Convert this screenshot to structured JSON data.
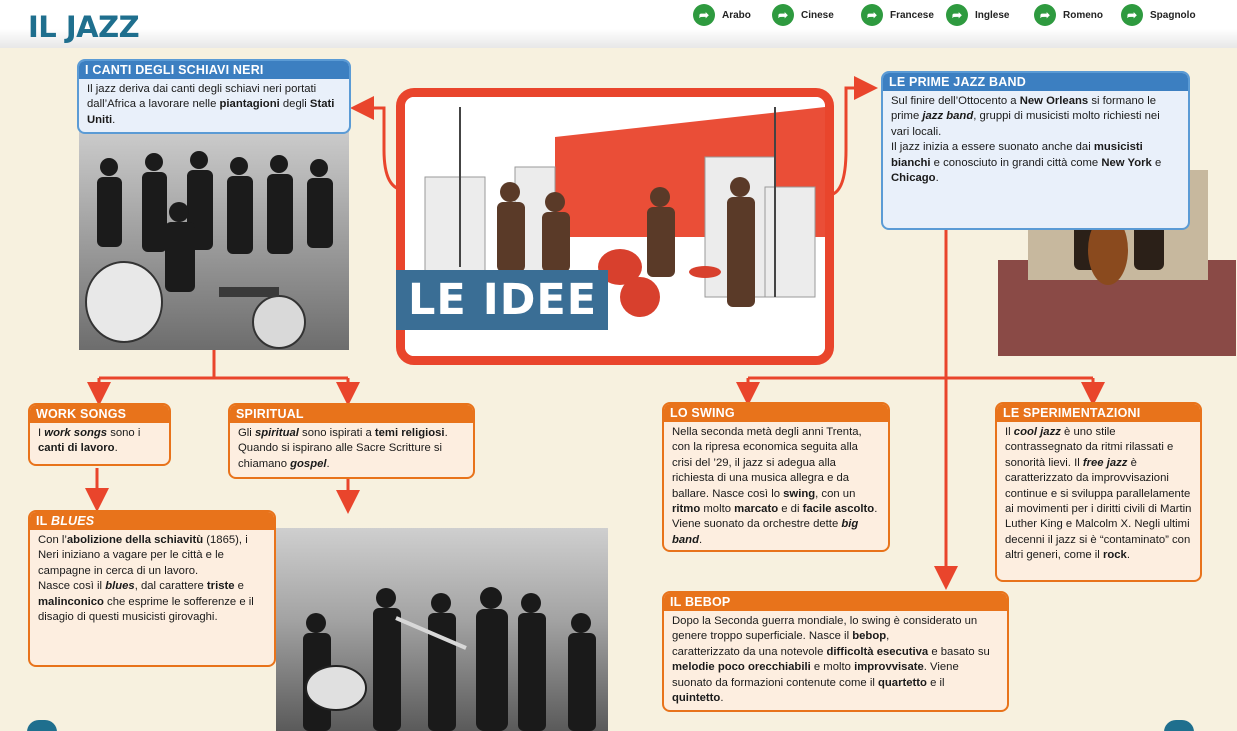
{
  "title": "IL JAZZ",
  "languages": [
    "Arabo",
    "Cinese",
    "Francese",
    "Inglese",
    "Romeno",
    "Spagnolo"
  ],
  "hub_label": "LE IDEE",
  "boxes": {
    "canti": {
      "title": "I CANTI DEGLI SCHIAVI NERI",
      "parts": [
        [
          "Il jazz deriva dai canti degli schiavi neri portati dall’Africa a lavorare nelle ",
          ""
        ],
        [
          "piantagioni",
          "b"
        ],
        [
          " degli ",
          ""
        ],
        [
          "Stati Uniti",
          "b"
        ],
        [
          ".",
          ""
        ]
      ]
    },
    "prime": {
      "title": "LE PRIME JAZZ BAND",
      "parts": [
        [
          "Sul finire dell’Ottocento a ",
          ""
        ],
        [
          "New Orleans",
          "b"
        ],
        [
          " si formano le prime ",
          ""
        ],
        [
          "jazz band",
          "bi"
        ],
        [
          ", gruppi di musicisti molto richiesti nei vari locali.",
          ""
        ],
        [
          "\n",
          "br"
        ],
        [
          "Il jazz inizia a essere suonato anche dai ",
          ""
        ],
        [
          "musicisti bianchi",
          "b"
        ],
        [
          " e conosciuto in grandi città come ",
          ""
        ],
        [
          "New York",
          "b"
        ],
        [
          " e ",
          ""
        ],
        [
          "Chicago",
          "b"
        ],
        [
          ".",
          ""
        ]
      ]
    },
    "work": {
      "title": "WORK SONGS",
      "parts": [
        [
          "I ",
          ""
        ],
        [
          "work songs",
          "bi"
        ],
        [
          " sono i ",
          ""
        ],
        [
          "canti di lavoro",
          "b"
        ],
        [
          ".",
          ""
        ]
      ]
    },
    "spiritual": {
      "title": "SPIRITUAL",
      "parts": [
        [
          "Gli ",
          ""
        ],
        [
          "spiritual",
          "bi"
        ],
        [
          " sono ispirati a ",
          ""
        ],
        [
          "temi religiosi",
          "b"
        ],
        [
          ". Quando si ispirano alle Sacre Scritture si chiamano ",
          ""
        ],
        [
          "gospel",
          "bi"
        ],
        [
          ".",
          ""
        ]
      ]
    },
    "blues": {
      "title_plain": "IL ",
      "title_italic": "BLUES",
      "parts": [
        [
          "Con l’",
          ""
        ],
        [
          "abolizione della schiavitù",
          "b"
        ],
        [
          " (1865), i Neri iniziano a vagare per le città e le campagne in cerca di un lavoro.",
          ""
        ],
        [
          "\n",
          "br"
        ],
        [
          "Nasce così il ",
          ""
        ],
        [
          "blues",
          "bi"
        ],
        [
          ", dal carattere ",
          ""
        ],
        [
          "triste",
          "b"
        ],
        [
          " e ",
          ""
        ],
        [
          "malinconico",
          "b"
        ],
        [
          " che esprime le sofferenze e il disagio di questi musicisti girovaghi.",
          ""
        ]
      ]
    },
    "swing": {
      "title": "LO SWING",
      "parts": [
        [
          "Nella seconda metà degli anni Trenta, con la ripresa economica seguita alla crisi del ’29, il jazz si adegua alla richiesta di una musica allegra e da ballare. Nasce così lo ",
          ""
        ],
        [
          "swing",
          "b"
        ],
        [
          ", con un ",
          ""
        ],
        [
          "ritmo",
          "b"
        ],
        [
          " molto ",
          ""
        ],
        [
          "marcato",
          "b"
        ],
        [
          " e di ",
          ""
        ],
        [
          "facile ascolto",
          "b"
        ],
        [
          ". Viene suonato da orchestre dette ",
          ""
        ],
        [
          "big band",
          "bi"
        ],
        [
          ".",
          ""
        ]
      ]
    },
    "speriment": {
      "title": "LE SPERIMENTAZIONI",
      "parts": [
        [
          "Il ",
          ""
        ],
        [
          "cool jazz",
          "bi"
        ],
        [
          " è uno stile contrassegnato da ritmi rilassati e sonorità lievi. Il ",
          ""
        ],
        [
          "free jazz",
          "bi"
        ],
        [
          " è caratterizzato da improvvisazioni continue e si sviluppa parallelamente ai movimenti per i diritti civili di Martin Luther King e Malcolm X. Negli ultimi decenni il jazz si è “contaminato” con altri generi, come il ",
          ""
        ],
        [
          "rock",
          "b"
        ],
        [
          ".",
          ""
        ]
      ]
    },
    "bebop": {
      "title": "IL BEBOP",
      "parts": [
        [
          "Dopo la Seconda guerra mondiale, lo swing è considerato un genere troppo superficiale. Nasce il ",
          ""
        ],
        [
          "bebop",
          "b"
        ],
        [
          ",",
          ""
        ],
        [
          "\n",
          "br"
        ],
        [
          "caratterizzato da una notevole ",
          ""
        ],
        [
          "difficoltà esecutiva",
          "b"
        ],
        [
          " e basato su ",
          ""
        ],
        [
          "melodie poco orecchiabili",
          "b"
        ],
        [
          " e molto ",
          ""
        ],
        [
          "improvvisate",
          "b"
        ],
        [
          ". Viene suonato da formazioni contenute come il ",
          ""
        ],
        [
          "quartetto",
          "b"
        ],
        [
          " e il ",
          ""
        ],
        [
          "quintetto",
          "b"
        ],
        [
          ".",
          ""
        ]
      ]
    }
  },
  "colors": {
    "accent_red": "#e9452c",
    "orange": "#e8731b",
    "blue": "#3c7fc1",
    "title_blue": "#1f6f8e",
    "page_bg": "#f7f1df"
  }
}
